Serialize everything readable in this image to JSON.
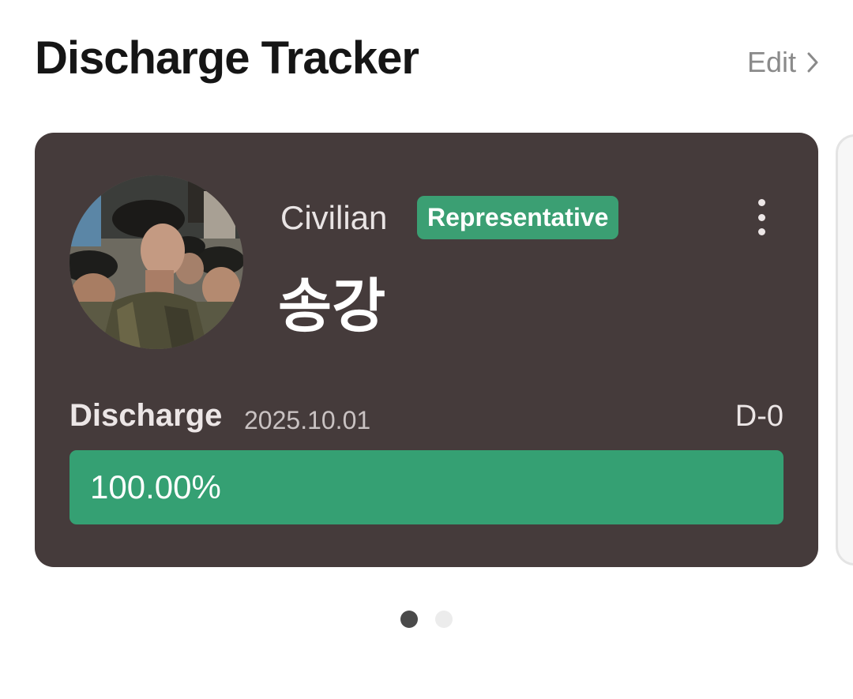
{
  "header": {
    "title": "Discharge Tracker",
    "edit_label": "Edit"
  },
  "card": {
    "avatar": "avatar-photo-soldier-beret",
    "status": "Civilian",
    "badge": "Representative",
    "name": "송강",
    "discharge_label": "Discharge",
    "discharge_date": "2025.10.01",
    "d_day": "D-0",
    "progress_percent": 100,
    "progress_text": "100.00%"
  },
  "pager": {
    "count": 2,
    "active_index": 0
  },
  "colors": {
    "card_bg": "#453b3b",
    "accent_green": "#35a073",
    "badge_green": "#3b9f73",
    "title": "#151515",
    "muted": "#8a8a8a"
  },
  "icons": {
    "edit": "chevron-right-icon",
    "more": "more-vertical-icon"
  }
}
